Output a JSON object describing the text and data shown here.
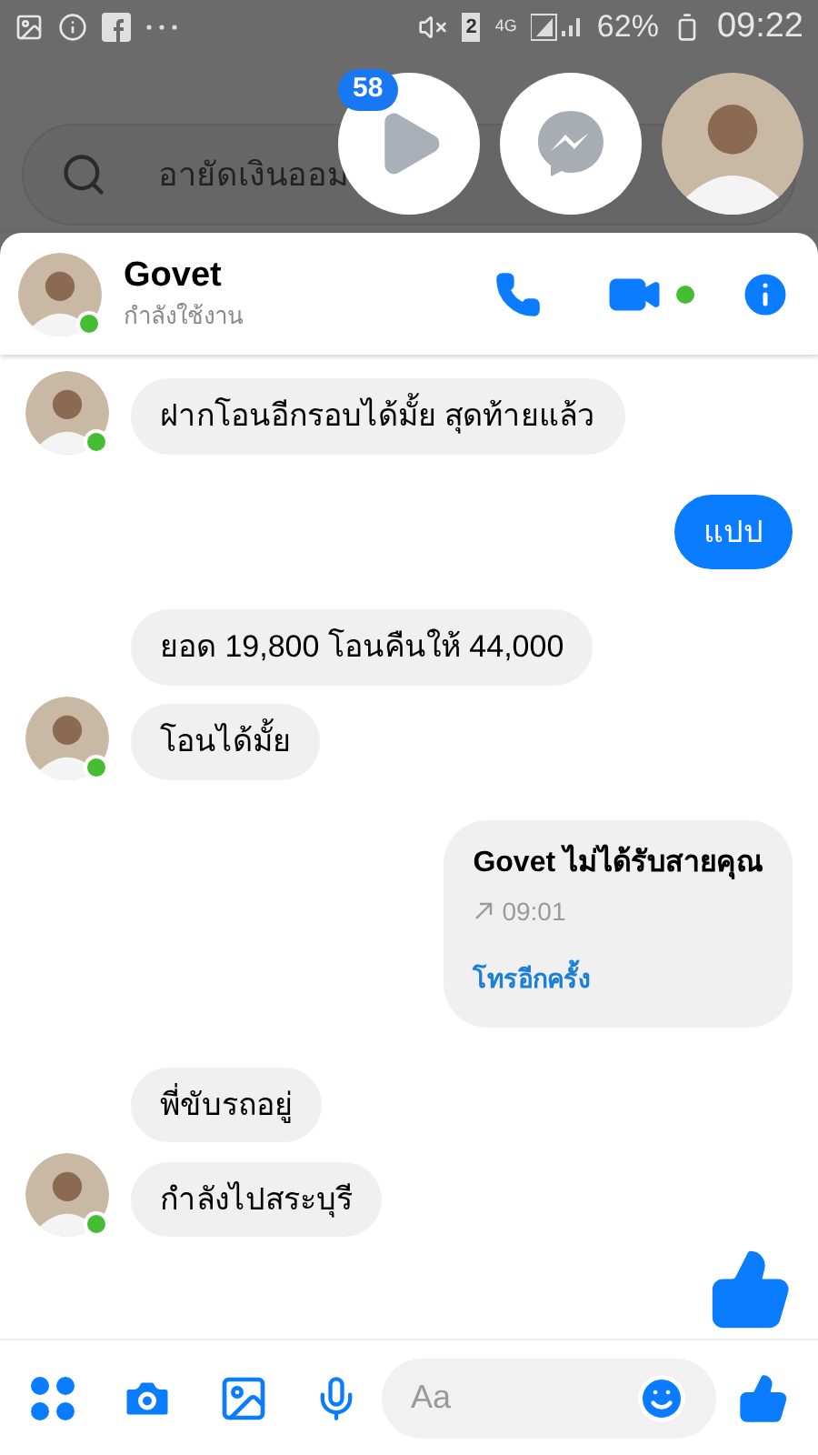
{
  "status_bar": {
    "sim_badge": "2",
    "network": "4G",
    "battery": "62%",
    "time": "09:22"
  },
  "search": {
    "value": "อายัดเงินออม"
  },
  "chat_heads": {
    "badge": "58"
  },
  "header": {
    "name": "Govet",
    "status": "กำลังใช้งาน",
    "online": true
  },
  "messages": [
    {
      "kind": "text",
      "outgoing": false,
      "text": "ฝากโอนอีกรอบได้มั้ย สุดท้ายแล้ว",
      "avatar": true
    },
    {
      "kind": "text",
      "outgoing": true,
      "text": "แปป"
    },
    {
      "kind": "text",
      "outgoing": false,
      "text": "ยอด 19,800 โอนคืนให้ 44,000",
      "avatar": false
    },
    {
      "kind": "text",
      "outgoing": false,
      "text": "โอนได้มั้ย",
      "avatar": true
    },
    {
      "kind": "missed_call",
      "outgoing": true,
      "title": "Govet ไม่ได้รับสายคุณ",
      "time": "09:01",
      "action": "โทรอีกครั้ง"
    },
    {
      "kind": "text",
      "outgoing": false,
      "text": "พี่ขับรถอยู่",
      "avatar": false
    },
    {
      "kind": "text",
      "outgoing": false,
      "text": "กำลังไปสระบุรี",
      "avatar": true
    },
    {
      "kind": "like",
      "outgoing": true
    }
  ],
  "composer": {
    "placeholder": "Aa"
  }
}
